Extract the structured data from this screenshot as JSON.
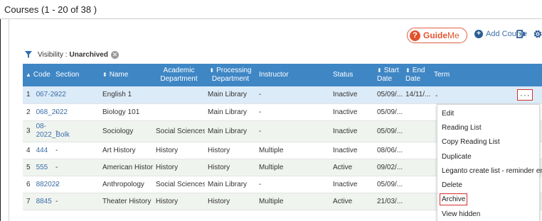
{
  "page": {
    "title": "Courses (1 - 20 of 38 )"
  },
  "toolbar": {
    "guideme_q": "?",
    "guideme_part1": "Guide",
    "guideme_part2": "Me",
    "add_course_label": "Add Course",
    "add_icon": "plus-circle-icon",
    "export_icon": "export-icon",
    "settings_icon": "gear-icon"
  },
  "filter": {
    "label": "Visibility : ",
    "value": "Unarchived",
    "clear_glyph": "⊗"
  },
  "table": {
    "columns": {
      "code": "Code",
      "section": "Section",
      "name": "Name",
      "academic_dept_1": "Academic",
      "academic_dept_2": "Department",
      "processing_dept_1": "Processing",
      "processing_dept_2": "Department",
      "instructor": "Instructor",
      "status": "Status",
      "start_date_1": "Start",
      "start_date_2": "Date",
      "end_date_1": "End",
      "end_date_2": "Date",
      "term": "Term"
    },
    "rows": [
      {
        "num": "1",
        "code": "067-2022",
        "section": "-",
        "name": "English 1",
        "academic_dept": "",
        "processing_dept": "Main Library",
        "instructor": "-",
        "status": "Inactive",
        "start": "05/09/...",
        "end": "14/11/...",
        "term": "-"
      },
      {
        "num": "2",
        "code": "068_2022",
        "section": "-",
        "name": "Biology 101",
        "academic_dept": "",
        "processing_dept": "Main Library",
        "instructor": "-",
        "status": "Inactive",
        "start": "05/09/...",
        "end": "",
        "term": ""
      },
      {
        "num": "3",
        "code": "08-2022_Bolk",
        "section": "-",
        "name": "Sociology",
        "academic_dept": "Social Sciences",
        "processing_dept": "Main Library",
        "instructor": "-",
        "status": "Inactive",
        "start": "05/09/...",
        "end": "",
        "term": ""
      },
      {
        "num": "4",
        "code": "444",
        "section": "-",
        "name": "Art History",
        "academic_dept": "History",
        "processing_dept": "History",
        "instructor": "Multiple",
        "status": "Inactive",
        "start": "08/06/...",
        "end": "",
        "term": ""
      },
      {
        "num": "5",
        "code": "555",
        "section": "-",
        "name": "American History",
        "academic_dept": "History",
        "processing_dept": "History",
        "instructor": "Multiple",
        "status": "Active",
        "start": "09/02/...",
        "end": "",
        "term": ""
      },
      {
        "num": "6",
        "code": "882022",
        "section": "-",
        "name": "Anthropology",
        "academic_dept": "Social Sciences",
        "processing_dept": "Main Library",
        "instructor": "-",
        "status": "Inactive",
        "start": "05/09/...",
        "end": "",
        "term": ""
      },
      {
        "num": "7",
        "code": "8845",
        "section": "-",
        "name": "Theater History",
        "academic_dept": "History",
        "processing_dept": "History",
        "instructor": "Multiple",
        "status": "Active",
        "start": "21/03/...",
        "end": "",
        "term": ""
      }
    ],
    "row_actions_glyph": "···"
  },
  "context_menu": {
    "items": [
      "Edit",
      "Reading List",
      "Copy Reading List",
      "Duplicate",
      "Leganto create list - reminder email",
      "Delete",
      "Archive",
      "View hidden"
    ]
  },
  "colors": {
    "header_bg": "#3f86c5",
    "accent_red": "#d0312d",
    "link_blue": "#3b6fa8",
    "guideme_orange": "#e2532e"
  }
}
